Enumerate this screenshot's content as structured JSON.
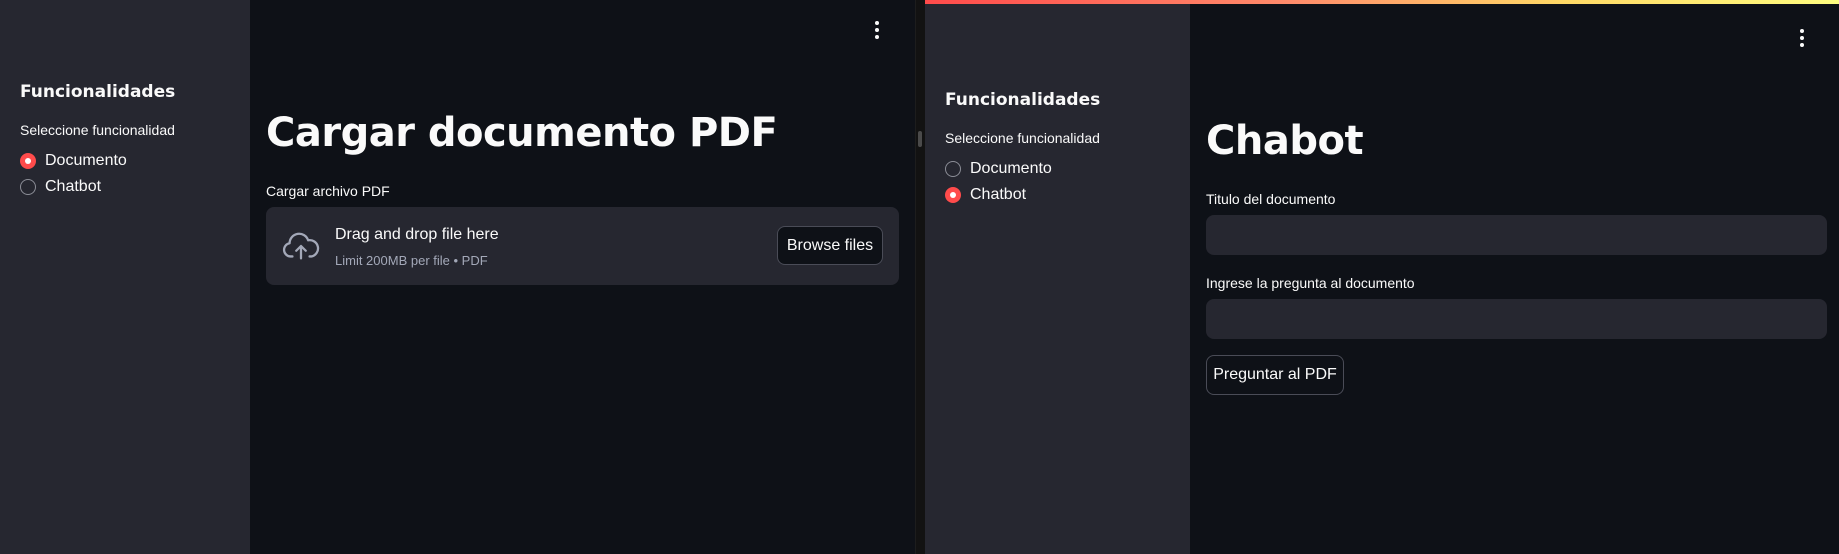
{
  "left": {
    "sidebar": {
      "title": "Funcionalidades",
      "radio_label": "Seleccione funcionalidad",
      "options": [
        {
          "label": "Documento",
          "selected": true
        },
        {
          "label": "Chatbot",
          "selected": false
        }
      ]
    },
    "main": {
      "title": "Cargar documento PDF",
      "uploader": {
        "label": "Cargar archivo PDF",
        "dropzone_text": "Drag and drop file here",
        "limit_text": "Limit 200MB per file • PDF",
        "browse_label": "Browse files"
      }
    }
  },
  "right": {
    "sidebar": {
      "title": "Funcionalidades",
      "radio_label": "Seleccione funcionalidad",
      "options": [
        {
          "label": "Documento",
          "selected": false
        },
        {
          "label": "Chatbot",
          "selected": true
        }
      ]
    },
    "main": {
      "title": "Chabot",
      "title_field": {
        "label": "Titulo del documento",
        "value": ""
      },
      "question_field": {
        "label": "Ingrese la pregunta al documento",
        "value": ""
      },
      "ask_button": "Preguntar al PDF"
    }
  },
  "colors": {
    "background": "#0e1117",
    "sidebar": "#262730",
    "accent": "#ff4b4b",
    "text": "#fafafa",
    "muted_text": "#a3a8b8"
  },
  "icons": [
    "upload-cloud-icon",
    "kebab-menu-icon"
  ]
}
